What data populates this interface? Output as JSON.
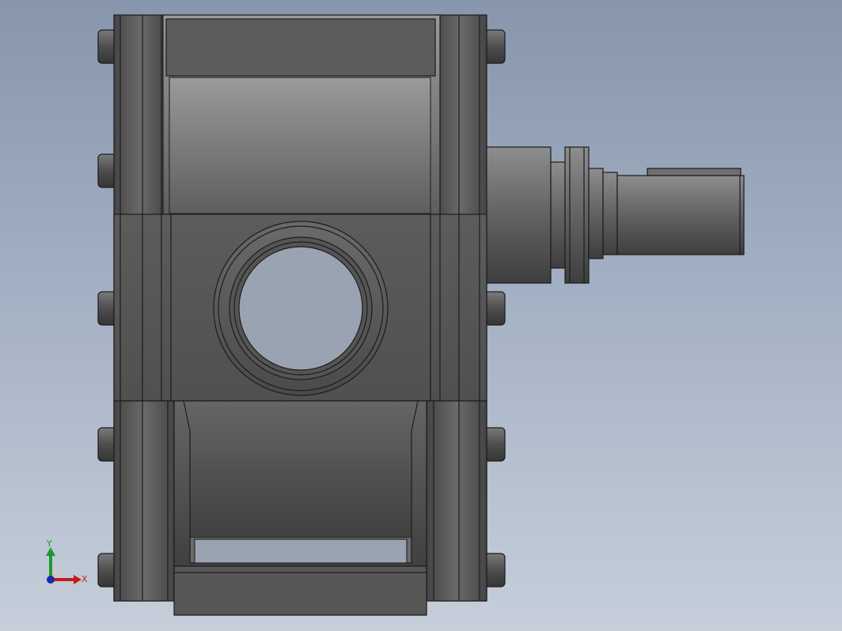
{
  "viewport": {
    "background_top": "#8796ac",
    "background_bottom": "#c6ceda"
  },
  "model": {
    "body_color": "#5a5a5a",
    "edge_color": "#1c1c1c",
    "parts": [
      "gearbox-housing",
      "flange-bolts",
      "output-shaft",
      "bore-hole",
      "base-plate"
    ]
  },
  "triad": {
    "x_label": "X",
    "y_label": "Y",
    "x_color": "#c41a1a",
    "y_color": "#1a9a2a",
    "z_color": "#1a2aa8"
  }
}
